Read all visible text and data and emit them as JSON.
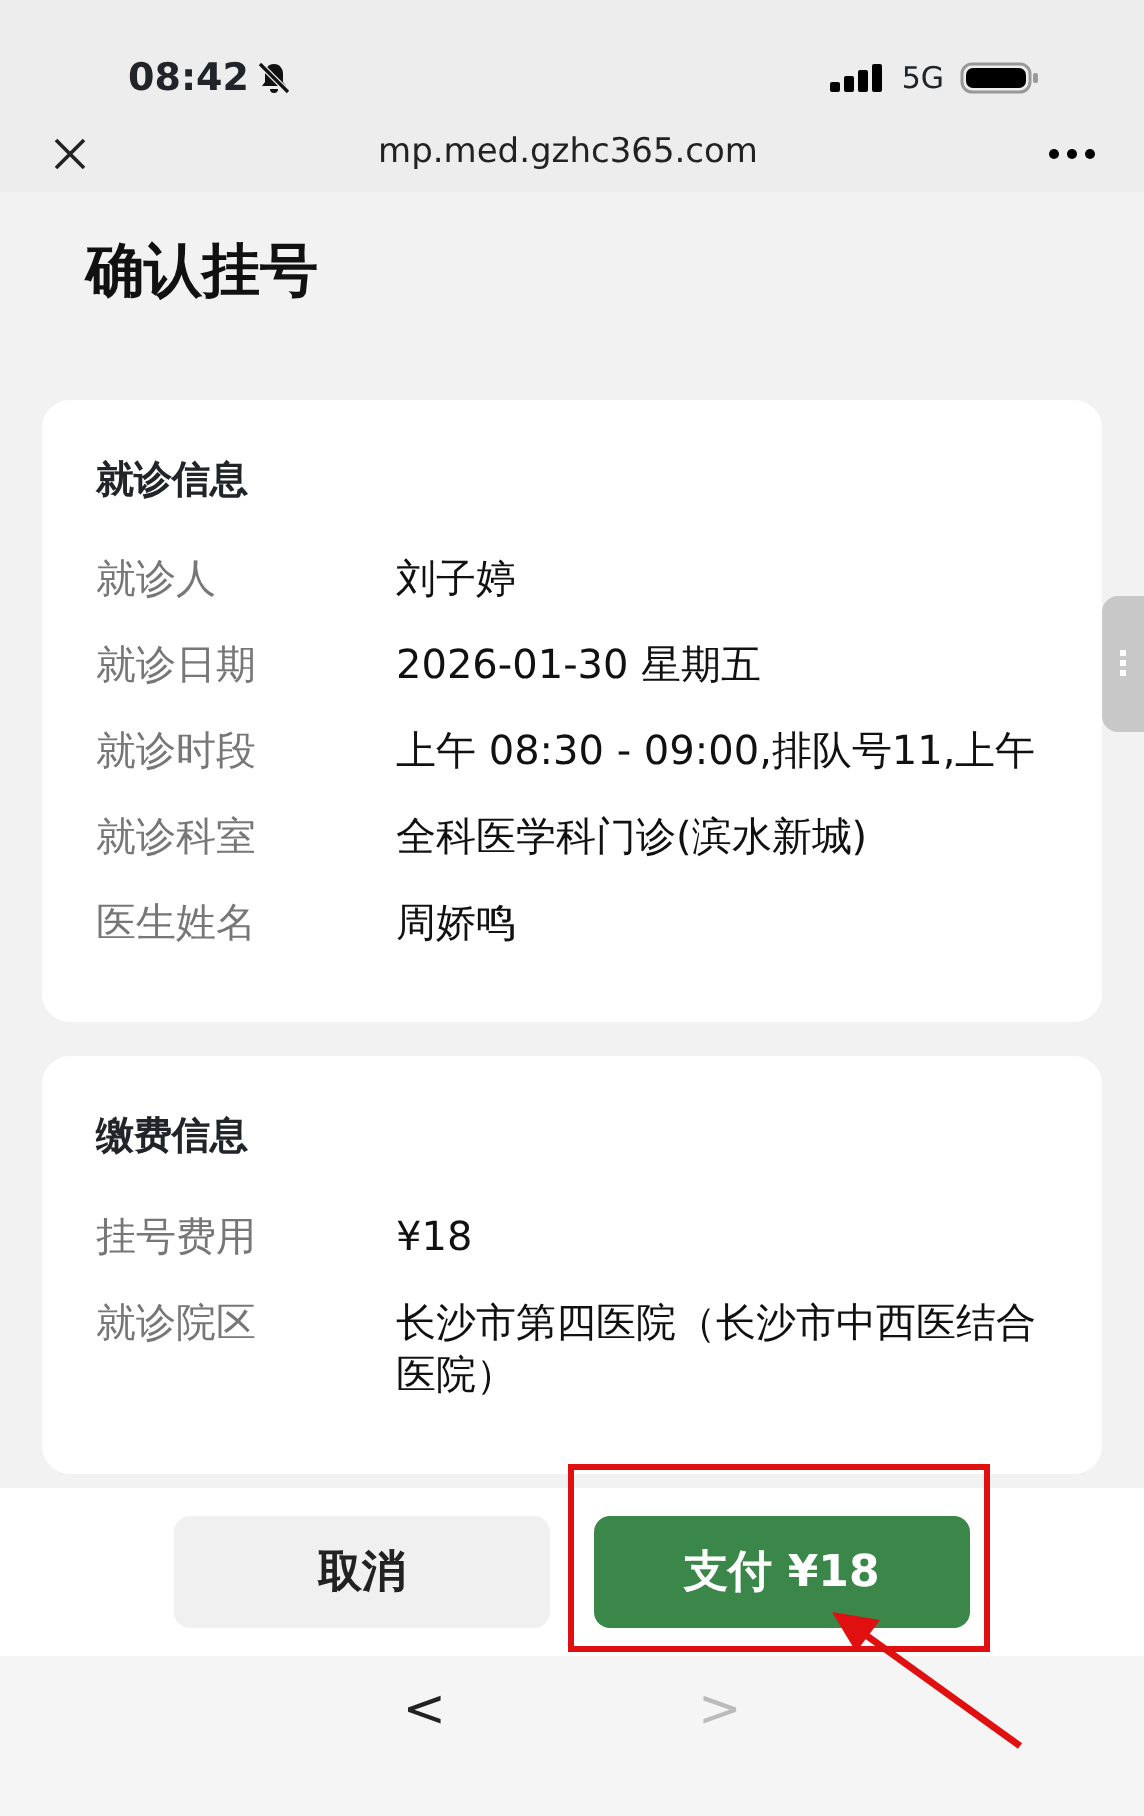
{
  "status_bar": {
    "time": "08:42",
    "network": "5G"
  },
  "browser_bar": {
    "url": "mp.med.gzhc365.com"
  },
  "page_title": "确认挂号",
  "sections": [
    {
      "title": "就诊信息",
      "rows": [
        {
          "label": "就诊人",
          "value": "刘子婷"
        },
        {
          "label": "就诊日期",
          "value": "2026-01-30 星期五"
        },
        {
          "label": "就诊时段",
          "value": "上午 08:30 - 09:00,排队号11,上午"
        },
        {
          "label": "就诊科室",
          "value": "全科医学科门诊(滨水新城)"
        },
        {
          "label": "医生姓名",
          "value": "周娇鸣"
        }
      ]
    },
    {
      "title": "缴费信息",
      "rows": [
        {
          "label": "挂号费用",
          "value": "¥18"
        },
        {
          "label": "就诊院区",
          "value": "长沙市第四医院（长沙市中西医结合医院）"
        }
      ]
    }
  ],
  "actions": [
    {
      "label": "取消",
      "kind": "secondary"
    },
    {
      "label": "支付 ¥18",
      "kind": "primary"
    }
  ],
  "nav": [
    {
      "label": "<",
      "disabled": false
    },
    {
      "label": ">",
      "disabled": true
    }
  ]
}
